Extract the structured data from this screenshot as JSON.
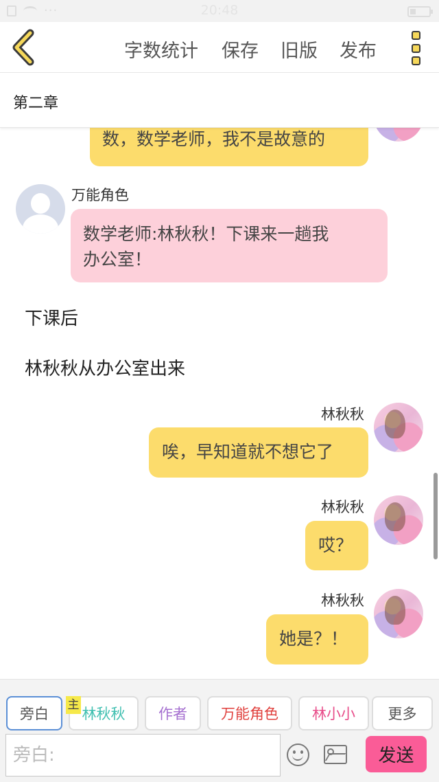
{
  "status_bar": {
    "time": "20:48"
  },
  "toolbar": {
    "word_count": "字数统计",
    "save": "保存",
    "old_version": "旧版",
    "publish": "发布"
  },
  "chapter": {
    "title": "第二章"
  },
  "messages": [
    {
      "type": "bubble",
      "side": "right",
      "text": "数，数学老师，我不是故意的"
    },
    {
      "type": "bubble",
      "side": "left",
      "speaker": "万能角色",
      "text_line1": "数学老师:林秋秋！下课来一趟我",
      "text_line2": "办公室！"
    },
    {
      "type": "narration",
      "text": "下课后"
    },
    {
      "type": "narration",
      "text": "林秋秋从办公室出来"
    },
    {
      "type": "bubble",
      "side": "right",
      "speaker": "林秋秋",
      "text": "唉，早知道就不想它了"
    },
    {
      "type": "bubble",
      "side": "right",
      "speaker": "林秋秋",
      "text": "哎？"
    },
    {
      "type": "bubble",
      "side": "right",
      "speaker": "林秋秋",
      "text": "她是？！"
    }
  ],
  "roles": [
    {
      "label": "旁白",
      "color": "#555555",
      "selected": true
    },
    {
      "label": "林秋秋",
      "color": "#3fbfb0",
      "badge": "主"
    },
    {
      "label": "作者",
      "color": "#a56fd0"
    },
    {
      "label": "万能角色",
      "color": "#e0413e"
    },
    {
      "label": "林小小",
      "color": "#e84d8a"
    },
    {
      "label": "更多",
      "color": "#555555"
    }
  ],
  "input": {
    "placeholder": "旁白:"
  },
  "send_label": "发送",
  "colors": {
    "bubble_yellow": "#fcdc6c",
    "bubble_pink": "#fdd0da",
    "send_button": "#fa5c97",
    "icon_yellow": "#f6d85a"
  }
}
